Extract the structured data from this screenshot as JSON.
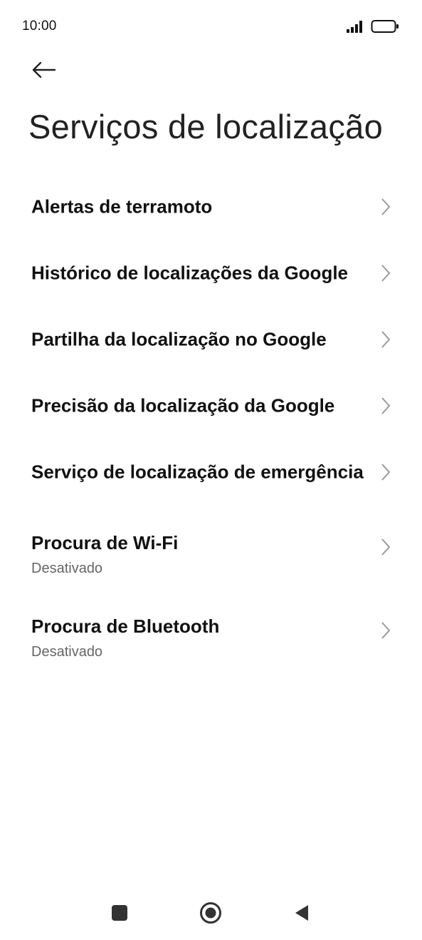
{
  "status_bar": {
    "time": "10:00",
    "icons": [
      "signal-icon",
      "battery-icon"
    ]
  },
  "header": {
    "back_icon": "arrow-left-icon",
    "title": "Serviços de localização"
  },
  "items": [
    {
      "label": "Alertas de terramoto"
    },
    {
      "label": "Histórico de localizações da Google"
    },
    {
      "label": "Partilha da localização no Google"
    },
    {
      "label": "Precisão da localização da Google"
    },
    {
      "label": "Serviço de localização de emergência"
    },
    {
      "label": "Procura de Wi-Fi",
      "sub": "Desativado"
    },
    {
      "label": "Procura de Bluetooth",
      "sub": "Desativado"
    }
  ],
  "nav_bar": {
    "icons": [
      "recents-square-icon",
      "home-circle-icon",
      "back-triangle-icon"
    ]
  },
  "colors": {
    "text": "#111111",
    "subtext": "#666666",
    "chevron": "#9a9a9a",
    "background": "#ffffff"
  }
}
